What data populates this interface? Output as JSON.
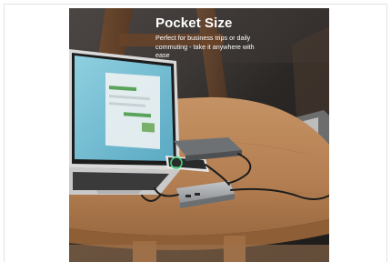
{
  "photo": {
    "headline": "Pocket Size",
    "subtext": "Perfect for business trips or daily commuting - take it anywhere with ease",
    "colors": {
      "table_wood": "#b98457",
      "table_edge": "#8e5e36",
      "background_wall": "#2f2c2a",
      "hub_body": "#a9acaf",
      "laptop_screen": "#7fc3d6",
      "headline_text": "#ffffff"
    }
  }
}
